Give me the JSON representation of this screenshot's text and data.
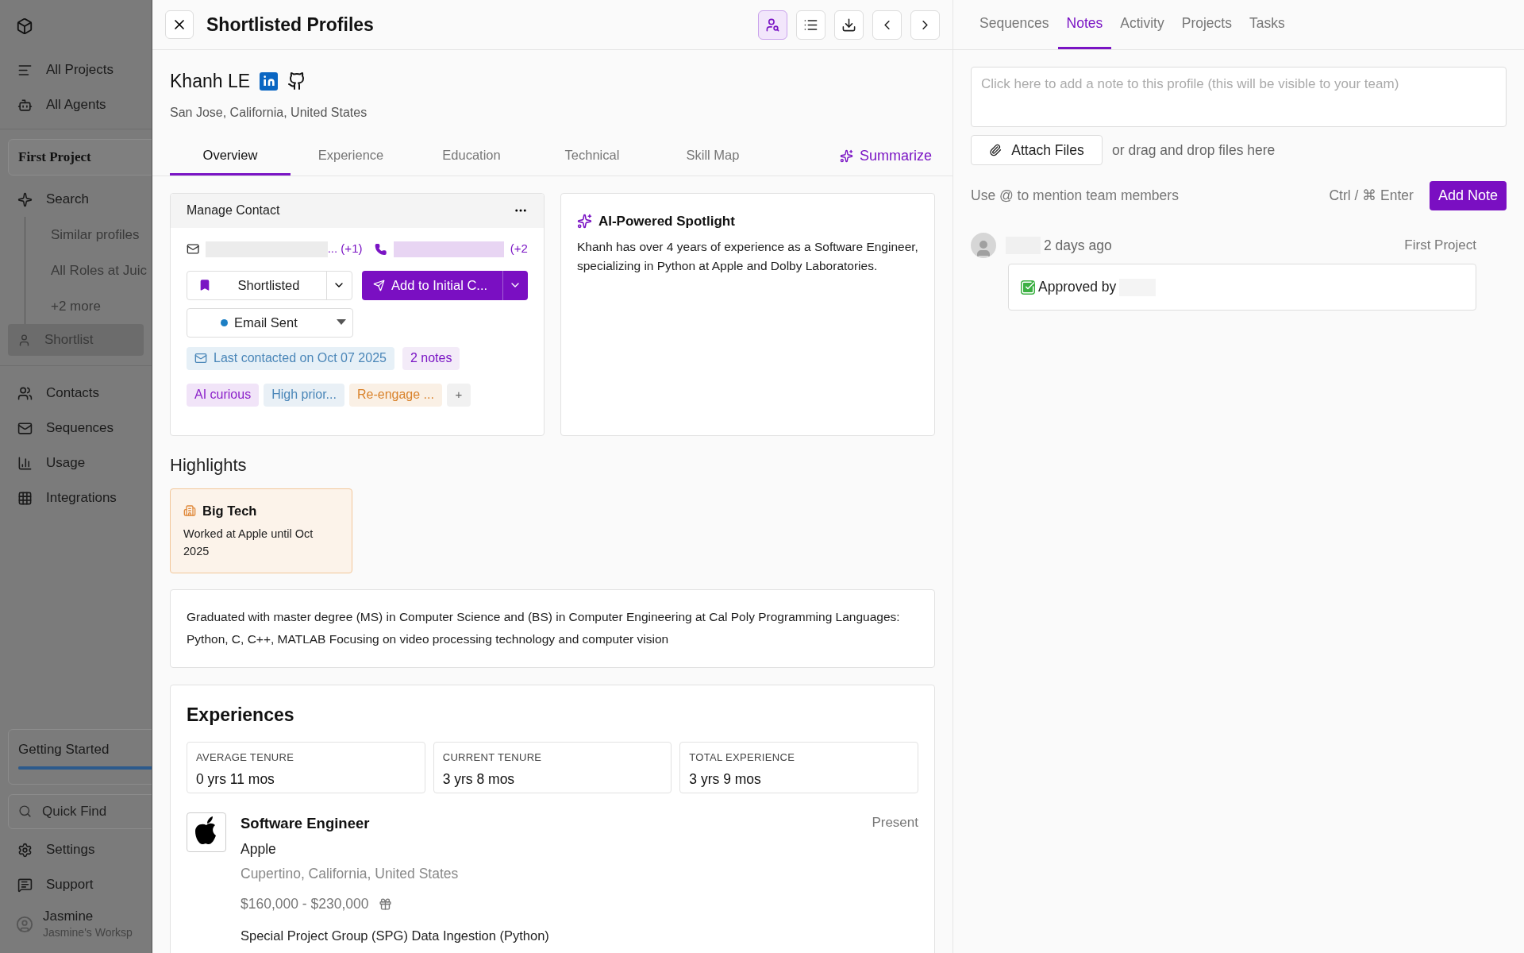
{
  "sidebar": {
    "nav": [
      {
        "label": "All Projects"
      },
      {
        "label": "All Agents"
      }
    ],
    "project": "First Project",
    "search": {
      "label": "Search",
      "children": [
        "Similar profiles",
        "All Roles at Juic",
        "+2 more"
      ]
    },
    "shortlist": {
      "label": "Shortlist",
      "selected": true
    },
    "items": [
      {
        "label": "Contacts"
      },
      {
        "label": "Sequences"
      },
      {
        "label": "Usage"
      },
      {
        "label": "Integrations"
      }
    ],
    "getting_started": {
      "label": "Getting Started",
      "level": 1
    },
    "quick_find": {
      "placeholder": "Quick Find"
    },
    "bottom": [
      {
        "label": "Settings"
      },
      {
        "label": "Support"
      }
    ],
    "user": {
      "name": "Jasmine",
      "workspace": "Jasmine's Worksp"
    }
  },
  "header": {
    "title": "Shortlisted Profiles",
    "tools": [
      {
        "selected": true
      },
      {
        "selected": false
      },
      {
        "selected": false
      },
      {
        "selected": false
      },
      {
        "selected": false
      }
    ]
  },
  "profile": {
    "name": "Khanh LE",
    "location": "San Jose, California, United States"
  },
  "tabs": [
    {
      "label": "Overview",
      "selected": true
    },
    {
      "label": "Experience",
      "selected": false
    },
    {
      "label": "Education",
      "selected": false
    },
    {
      "label": "Technical",
      "selected": false
    },
    {
      "label": "Skill Map",
      "selected": false
    }
  ],
  "summarize": "Summarize",
  "manage_contact": {
    "title": "Manage Contact",
    "email_more": "... (+1)",
    "phone_more": "(+2",
    "status": "Shortlisted",
    "action": "Add to Initial C...",
    "email_status": {
      "label": "Email Sent",
      "color": "#1d7fc4"
    },
    "last_contacted": "Last contacted on Oct 07 2025",
    "notes": "2 notes",
    "tags": [
      {
        "label": "AI curious",
        "color": "#8a1fc9"
      },
      {
        "label": "High prior...",
        "color": "#4a86b8"
      },
      {
        "label": "Re-engage ...",
        "color": "#d9822b"
      }
    ],
    "add_tag": "+"
  },
  "spotlight": {
    "title": "AI-Powered Spotlight",
    "text": "Khanh has over 4 years of experience as a Software Engineer, specializing in Python at Apple and Dolby Laboratories."
  },
  "highlights": {
    "title": "Highlights",
    "cards": [
      {
        "title": "Big Tech",
        "text": "Worked at Apple until Oct 2025"
      }
    ]
  },
  "education_summary": "Graduated with master degree (MS) in Computer Science and (BS) in Computer Engineering at Cal Poly Programming Languages: Python, C, C++, MATLAB Focusing on video processing technology and computer vision",
  "experiences": {
    "title": "Experiences",
    "stats": [
      {
        "label": "AVERAGE TENURE",
        "value": "0 yrs 11 mos"
      },
      {
        "label": "CURRENT TENURE",
        "value": "3 yrs 8 mos"
      },
      {
        "label": "TOTAL EXPERIENCE",
        "value": "3 yrs 9 mos"
      }
    ],
    "jobs": [
      {
        "title": "Software Engineer",
        "company": "Apple",
        "location": "Cupertino, California, United States",
        "salary": "$160,000 - $230,000",
        "period": "Present",
        "project": "Special Project Group (SPG) Data Ingestion (Python)"
      }
    ]
  },
  "right_tabs": [
    {
      "label": "Sequences",
      "selected": false
    },
    {
      "label": "Notes",
      "selected": true
    },
    {
      "label": "Activity",
      "selected": false
    },
    {
      "label": "Projects",
      "selected": false
    },
    {
      "label": "Tasks",
      "selected": false
    }
  ],
  "note_input": {
    "placeholder": "Click here to add a note to this profile (this will be visible to your team)"
  },
  "attach": "Attach Files",
  "drop_hint": "or drag and drop files here",
  "mention_hint": "Use @ to mention team members",
  "shortcut": "Ctrl / ⌘ Enter",
  "add_note": "Add Note",
  "notes": [
    {
      "time": "2 days ago",
      "project": "First Project",
      "text": "Approved by"
    }
  ]
}
